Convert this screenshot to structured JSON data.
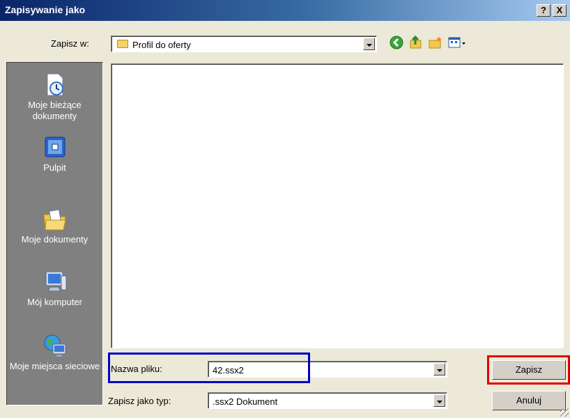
{
  "window": {
    "title": "Zapisywanie jako",
    "help_label": "?",
    "close_label": "X"
  },
  "save_in": {
    "label": "Zapisz w:",
    "value": "Profil do oferty"
  },
  "toolbar": {
    "icons": [
      "back-icon",
      "up-folder-icon",
      "new-folder-icon",
      "view-menu-icon"
    ]
  },
  "places": [
    {
      "label": "Moje bieżące dokumenty",
      "icon": "recent-documents-icon"
    },
    {
      "label": "Pulpit",
      "icon": "desktop-icon"
    },
    {
      "label": "Moje dokumenty",
      "icon": "my-documents-icon"
    },
    {
      "label": "Mój komputer",
      "icon": "my-computer-icon"
    },
    {
      "label": "Moje miejsca sieciowe",
      "icon": "network-places-icon"
    }
  ],
  "filename": {
    "label": "Nazwa pliku:",
    "value": "42.ssx2"
  },
  "filetype": {
    "label": "Zapisz jako typ:",
    "value": ".ssx2 Dokument"
  },
  "buttons": {
    "save": "Zapisz",
    "cancel": "Anuluj"
  },
  "colors": {
    "highlight_filename": "#0000c8",
    "highlight_save": "#e00000",
    "titlebar": "#0a246a"
  }
}
